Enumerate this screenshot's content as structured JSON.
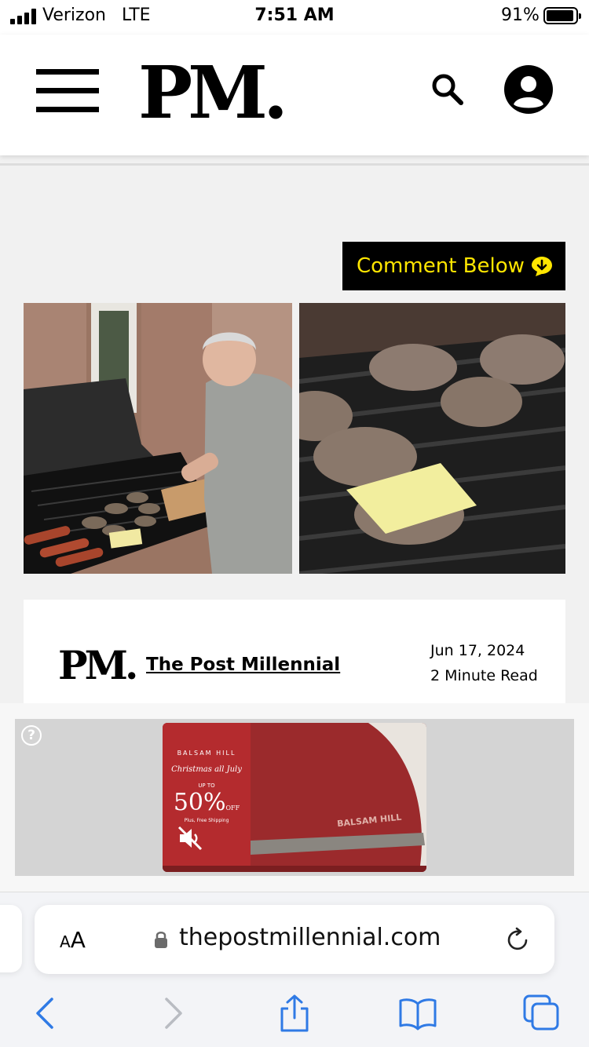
{
  "status_bar": {
    "carrier": "Verizon",
    "network": "LTE",
    "time": "7:51 AM",
    "battery": "91%",
    "battery_level": 0.91
  },
  "header": {
    "logo": "PM."
  },
  "article": {
    "comment_button_label": "Comment Below",
    "author": {
      "logo": "PM.",
      "name": "The Post Millennial",
      "date": "Jun 17, 2024",
      "read_time": "2 Minute Read"
    }
  },
  "ad": {
    "help_icon": "?",
    "brand": "BALSAM HILL",
    "tagline": "Christmas all July",
    "up_to": "UP TO",
    "discount": "50%",
    "off": "OFF",
    "shipping": "Plus, Free Shipping",
    "right_brand": "BALSAM HILL"
  },
  "browser": {
    "text_size_label_small": "A",
    "text_size_label_large": "A",
    "url": "thepostmillennial.com"
  },
  "colors": {
    "comment_text": "#ffe600",
    "ios_blue": "#2f7ae5",
    "ad_red": "#b42b2e"
  },
  "icons": [
    "hamburger-icon",
    "search-icon",
    "account-icon",
    "comment-download-icon",
    "help-icon",
    "mute-icon",
    "lock-icon",
    "reload-icon",
    "back-icon",
    "forward-icon",
    "share-icon",
    "bookmarks-icon",
    "tabs-icon"
  ]
}
